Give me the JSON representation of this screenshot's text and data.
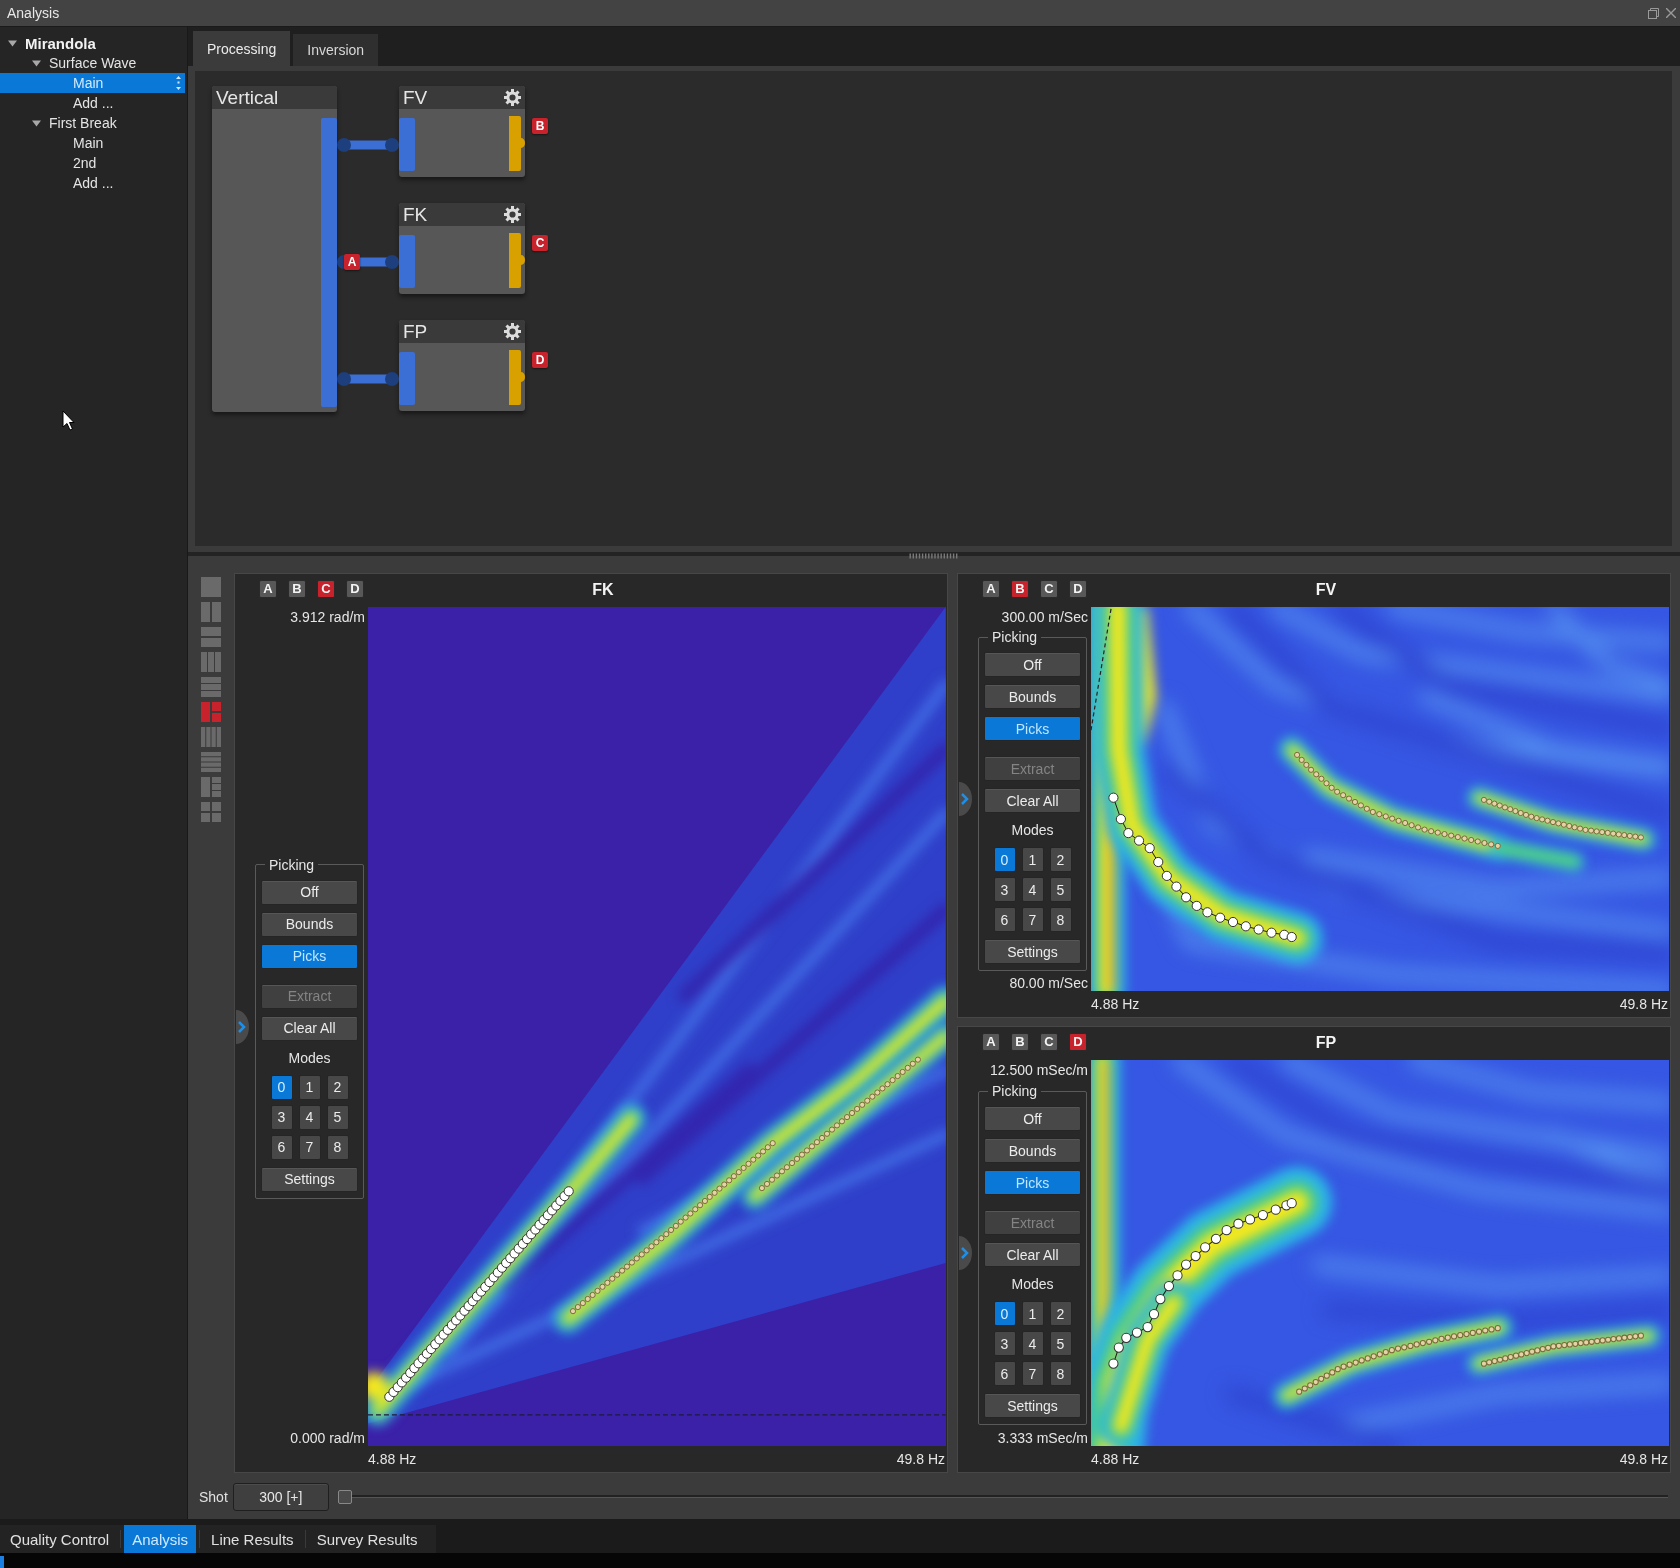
{
  "window": {
    "title": "Analysis"
  },
  "tree": [
    {
      "label": "Mirandola",
      "expanded": true,
      "selected": false,
      "children": [
        {
          "label": "Surface Wave",
          "expanded": true,
          "selected": false,
          "children": [
            {
              "label": "Main",
              "selected": true
            },
            {
              "label": "Add ...",
              "selected": false
            }
          ]
        },
        {
          "label": "First Break",
          "expanded": true,
          "selected": false,
          "children": [
            {
              "label": "Main",
              "selected": false
            },
            {
              "label": "2nd",
              "selected": false
            },
            {
              "label": "Add ...",
              "selected": false
            }
          ]
        }
      ]
    }
  ],
  "tabs": [
    {
      "label": "Processing",
      "selected": true
    },
    {
      "label": "Inversion",
      "selected": false
    }
  ],
  "flow_diagram": {
    "source": {
      "label": "Vertical",
      "tag": "A"
    },
    "nodes": [
      {
        "label": "FV",
        "tag": "B"
      },
      {
        "label": "FK",
        "tag": "C"
      },
      {
        "label": "FP",
        "tag": "D"
      }
    ]
  },
  "views": {
    "layouts": [
      {
        "kind": "single",
        "selected": false
      },
      {
        "kind": "columns2",
        "selected": false
      },
      {
        "kind": "rows2",
        "selected": false
      },
      {
        "kind": "columns3",
        "selected": false
      },
      {
        "kind": "rows3",
        "selected": false
      },
      {
        "kind": "split2",
        "selected": true
      },
      {
        "kind": "columns4",
        "selected": false
      },
      {
        "kind": "rows4",
        "selected": false
      },
      {
        "kind": "split3",
        "selected": false
      },
      {
        "kind": "grid",
        "selected": false
      }
    ],
    "panels": [
      {
        "kind": "fk",
        "title": "FK",
        "sources": [
          {
            "label": "A",
            "selected": false
          },
          {
            "label": "B",
            "selected": false
          },
          {
            "label": "C",
            "selected": true
          },
          {
            "label": "D",
            "selected": false
          }
        ],
        "y_top": "3.912 rad/m",
        "y_bottom": "0.000 rad/m",
        "x_left": "4.88 Hz",
        "x_right": "49.8 Hz",
        "picking": {
          "title": "Picking",
          "options": [
            {
              "label": "Off",
              "selected": false
            },
            {
              "label": "Bounds",
              "selected": false
            },
            {
              "label": "Picks",
              "selected": true
            }
          ],
          "actions": [
            {
              "label": "Extract",
              "disabled": true
            },
            {
              "label": "Clear All",
              "disabled": false
            }
          ],
          "modes_label": "Modes",
          "modes": [
            {
              "label": "0",
              "selected": true
            },
            {
              "label": "1",
              "selected": false
            },
            {
              "label": "2",
              "selected": false
            },
            {
              "label": "3",
              "selected": false
            },
            {
              "label": "4",
              "selected": false
            },
            {
              "label": "5",
              "selected": false
            },
            {
              "label": "6",
              "selected": false
            },
            {
              "label": "7",
              "selected": false
            },
            {
              "label": "8",
              "selected": false
            }
          ],
          "settings": "Settings"
        }
      },
      {
        "kind": "fv",
        "title": "FV",
        "sources": [
          {
            "label": "A",
            "selected": false
          },
          {
            "label": "B",
            "selected": true
          },
          {
            "label": "C",
            "selected": false
          },
          {
            "label": "D",
            "selected": false
          }
        ],
        "y_top": "300.00 m/Sec",
        "y_bottom": "80.00 m/Sec",
        "x_left": "4.88 Hz",
        "x_right": "49.8 Hz",
        "picking": {
          "title": "Picking",
          "options": [
            {
              "label": "Off",
              "selected": false
            },
            {
              "label": "Bounds",
              "selected": false
            },
            {
              "label": "Picks",
              "selected": true
            }
          ],
          "actions": [
            {
              "label": "Extract",
              "disabled": true
            },
            {
              "label": "Clear All",
              "disabled": false
            }
          ],
          "modes_label": "Modes",
          "modes": [
            {
              "label": "0",
              "selected": true
            },
            {
              "label": "1",
              "selected": false
            },
            {
              "label": "2",
              "selected": false
            },
            {
              "label": "3",
              "selected": false
            },
            {
              "label": "4",
              "selected": false
            },
            {
              "label": "5",
              "selected": false
            },
            {
              "label": "6",
              "selected": false
            },
            {
              "label": "7",
              "selected": false
            },
            {
              "label": "8",
              "selected": false
            }
          ],
          "settings": "Settings"
        }
      },
      {
        "kind": "fp",
        "title": "FP",
        "sources": [
          {
            "label": "A",
            "selected": false
          },
          {
            "label": "B",
            "selected": false
          },
          {
            "label": "C",
            "selected": false
          },
          {
            "label": "D",
            "selected": true
          }
        ],
        "y_top": "12.500 mSec/m",
        "y_bottom": "3.333 mSec/m",
        "x_left": "4.88 Hz",
        "x_right": "49.8 Hz",
        "picking": {
          "title": "Picking",
          "options": [
            {
              "label": "Off",
              "selected": false
            },
            {
              "label": "Bounds",
              "selected": false
            },
            {
              "label": "Picks",
              "selected": true
            }
          ],
          "actions": [
            {
              "label": "Extract",
              "disabled": true
            },
            {
              "label": "Clear All",
              "disabled": false
            }
          ],
          "modes_label": "Modes",
          "modes": [
            {
              "label": "0",
              "selected": true
            },
            {
              "label": "1",
              "selected": false
            },
            {
              "label": "2",
              "selected": false
            },
            {
              "label": "3",
              "selected": false
            },
            {
              "label": "4",
              "selected": false
            },
            {
              "label": "5",
              "selected": false
            },
            {
              "label": "6",
              "selected": false
            },
            {
              "label": "7",
              "selected": false
            },
            {
              "label": "8",
              "selected": false
            }
          ],
          "settings": "Settings"
        }
      }
    ]
  },
  "shot": {
    "label": "Shot",
    "selector": "300 [+]",
    "level": 0
  },
  "bottom_tabs": [
    {
      "label": "Quality Control",
      "selected": false
    },
    {
      "label": "Analysis",
      "selected": true
    },
    {
      "label": "Line Results",
      "selected": false
    },
    {
      "label": "Survey Results",
      "selected": false
    }
  ]
}
